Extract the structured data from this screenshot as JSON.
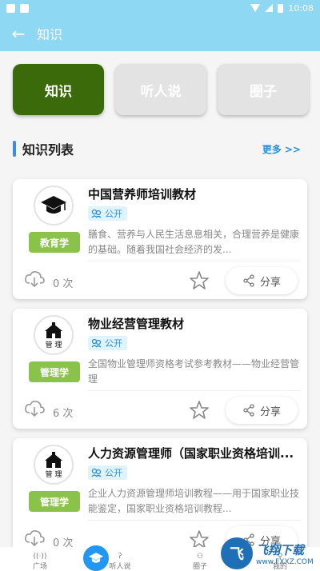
{
  "status": {
    "time": "10:08"
  },
  "header": {
    "back_icon": "arrow-left-icon",
    "title": "知识"
  },
  "tabs": [
    {
      "label": "知识",
      "active": true
    },
    {
      "label": "听人说",
      "active": false
    },
    {
      "label": "圈子",
      "active": false
    }
  ],
  "section": {
    "title": "知识列表",
    "more": "更多 >>"
  },
  "items": [
    {
      "title": "中国营养师培训教材",
      "visibility": "公开",
      "category": "教育学",
      "description": "膳食、营养与人民生活息息相关，合理营养是健康的基础。随着我国社会经济的发...",
      "downloads": "0 次",
      "share_label": "分享",
      "logo_label": ""
    },
    {
      "title": "物业经营管理教材",
      "visibility": "公开",
      "category": "管理学",
      "description": "全国物业管理师资格考试参考教材——物业经营管理",
      "downloads": "6 次",
      "share_label": "分享",
      "logo_label": "管 理"
    },
    {
      "title": "人力资源管理师（国家职业资格培训...",
      "visibility": "公开",
      "category": "管理学",
      "description": "企业人力资源管理师培训教程——用于国家职业技能鉴定，国家职业资格培训教程...",
      "downloads": "0 次",
      "share_label": "分享",
      "logo_label": "管 理"
    }
  ],
  "bottom_nav": [
    {
      "label": "广场",
      "icon": "broadcast-icon"
    },
    {
      "label": "听人说",
      "icon": "ear-icon"
    },
    {
      "label": "圈子",
      "icon": "group-icon"
    },
    {
      "label": "我的",
      "icon": "user-icon"
    }
  ],
  "watermark": {
    "title": "飞翔下载",
    "url": "www.FXXZ.COM",
    "mark": "飞"
  },
  "colors": {
    "header": "#8fd8f4",
    "active_tab": "#3a6a0a",
    "accent": "#2a8fd8",
    "category": "#8bc34a"
  }
}
